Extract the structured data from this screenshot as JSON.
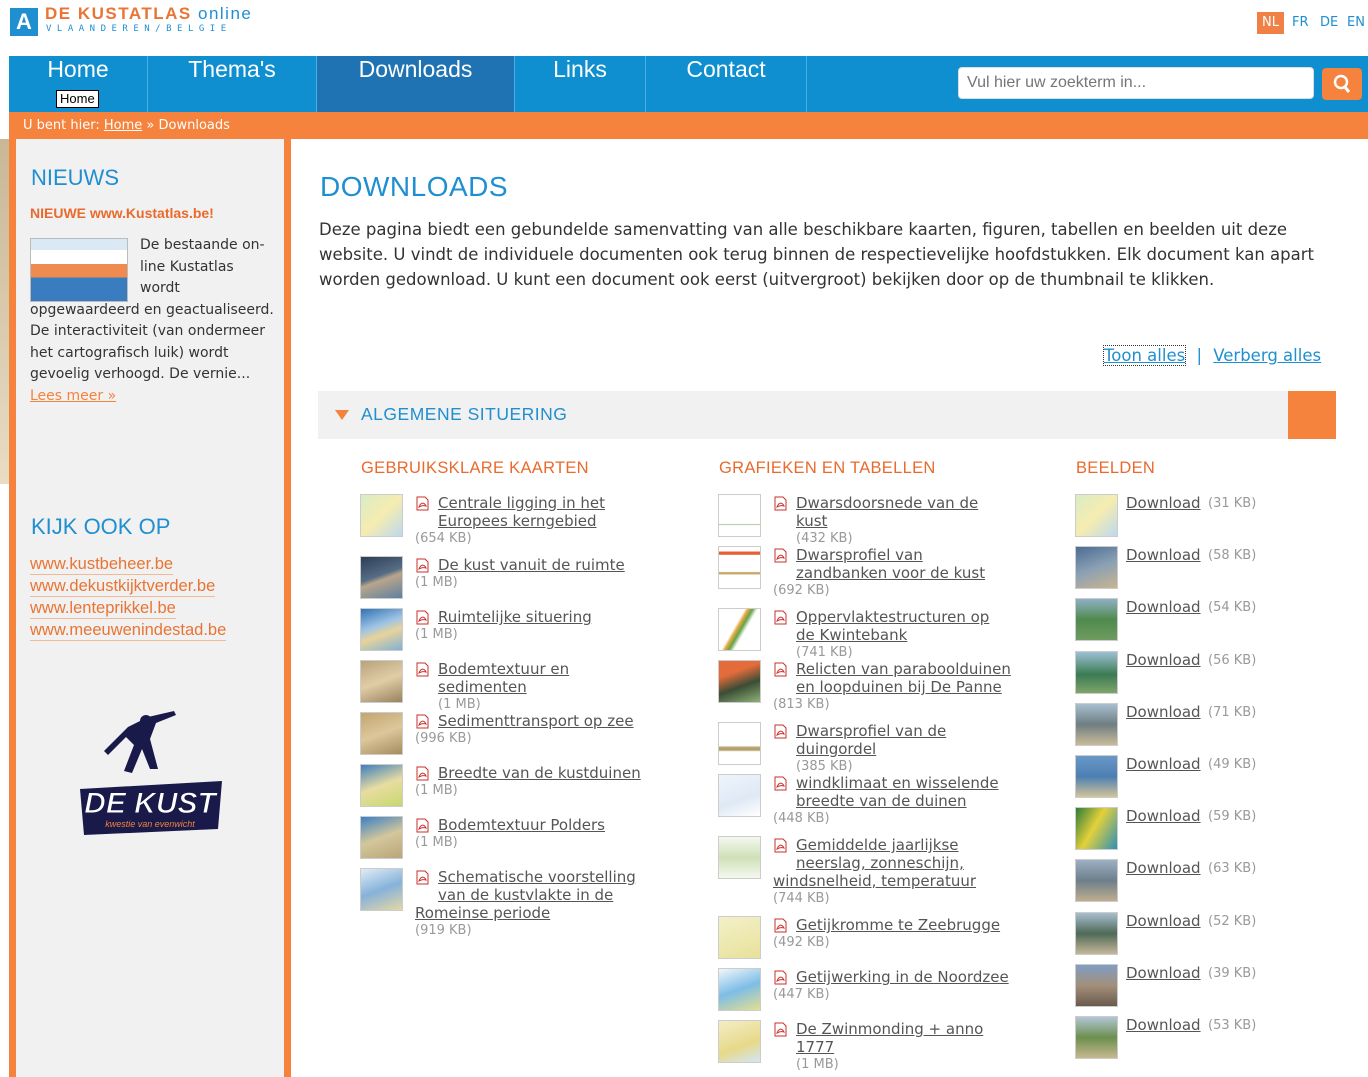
{
  "header": {
    "logo_letter": "A",
    "logo_title_part1": "DE KUSTATLAS",
    "logo_title_part2": "online",
    "logo_subtitle": "VLAANDEREN/BELGIE",
    "languages": [
      "NL",
      "FR",
      "DE",
      "EN"
    ],
    "active_language": "NL"
  },
  "nav": {
    "items": [
      "Home",
      "Thema's",
      "Downloads",
      "Links",
      "Contact"
    ],
    "active": "Downloads",
    "tooltip": "Home"
  },
  "search": {
    "placeholder": "Vul hier uw zoekterm in..."
  },
  "breadcrumb": {
    "prefix": "U bent hier:",
    "home": "Home",
    "separator": "»",
    "current": "Downloads"
  },
  "sidebar": {
    "news_heading": "NIEUWS",
    "news_title": "NIEUWE www.Kustatlas.be!",
    "news_text": "De bestaande on-line Kustatlas wordt opgewaardeerd en geactualiseerd. De interactiviteit (van ondermeer het cartografisch luik) wordt gevoelig verhoogd. De vernie...",
    "news_more": "Lees meer »",
    "see_also_heading": "KIJK OOK OP",
    "links": [
      "www.kustbeheer.be",
      "www.dekustkijktverder.be",
      "www.lenteprikkel.be",
      "www.meeuwenindestad.be"
    ],
    "logo_text": "DE KUST",
    "logo_tagline": "kwestie van evenwicht"
  },
  "main": {
    "title": "DOWNLOADS",
    "intro": "Deze pagina biedt een gebundelde samenvatting van alle beschikbare kaarten, figuren, tabellen en beelden uit deze website. U vindt de individuele documenten ook terug binnen de respectievelijke hoofdstukken. Elk document kan apart worden gedownload. U kunt een document ook eerst (uitvergroot) bekijken door op de thumbnail te klikken.",
    "show_all": "Toon alles",
    "toggle_sep": "|",
    "hide_all": "Verberg alles",
    "section": "ALGEMENE SITUERING",
    "columns": {
      "maps_heading": "GEBRUIKSKLARE KAARTEN",
      "charts_heading": "GRAFIEKEN EN TABELLEN",
      "images_heading": "BEELDEN"
    },
    "maps": [
      {
        "l1": "Centrale ligging in het",
        "l2": "Europees kerngebied",
        "l3": "",
        "size": "(654 KB)"
      },
      {
        "l1": "De kust vanuit de ruimte",
        "l2": "",
        "l3": "",
        "size": "(1 MB)"
      },
      {
        "l1": "Ruimtelijke situering",
        "l2": "",
        "l3": "",
        "size": "(1 MB)"
      },
      {
        "l1": "Bodemtextuur en",
        "l2": "sedimenten",
        "l3": "",
        "size": "(1 MB)"
      },
      {
        "l1": "Sedimenttransport op zee",
        "l2": "",
        "l3": "",
        "size": "(996 KB)"
      },
      {
        "l1": "Breedte van de kustduinen",
        "l2": "",
        "l3": "",
        "size": "(1 MB)"
      },
      {
        "l1": "Bodemtextuur Polders",
        "l2": "",
        "l3": "",
        "size": "(1 MB)"
      },
      {
        "l1": "Schematische voorstelling",
        "l2": "van de kustvlakte in de",
        "l3": "Romeinse periode",
        "size": "(919 KB)"
      }
    ],
    "charts": [
      {
        "l1": "Dwarsdoorsnede van de",
        "l2": "kust",
        "l3": "",
        "l4": "",
        "size": "(432 KB)"
      },
      {
        "l1": "Dwarsprofiel van",
        "l2": "zandbanken voor de kust",
        "l3": "",
        "l4": "",
        "size": "(692 KB)"
      },
      {
        "l1": "Oppervlaktestructuren op",
        "l2": "de Kwintebank",
        "l3": "",
        "l4": "",
        "size": "(741 KB)"
      },
      {
        "l1": "Relicten van paraboolduinen",
        "l2": "en loopduinen bij De Panne",
        "l3": "",
        "l4": "",
        "size": "(813 KB)"
      },
      {
        "l1": "Dwarsprofiel van de",
        "l2": "duingordel",
        "l3": "",
        "l4": "",
        "size": "(385 KB)"
      },
      {
        "l1": "windklimaat en wisselende",
        "l2": "breedte van de duinen",
        "l3": "",
        "l4": "",
        "size": "(448 KB)"
      },
      {
        "l1": "Gemiddelde jaarlijkse",
        "l2": "neerslag, zonneschijn,",
        "l3": "windsnelheid, temperatuur",
        "l4": "",
        "size": "(744 KB)"
      },
      {
        "l1": "Getijkromme te Zeebrugge",
        "l2": "",
        "l3": "",
        "l4": "",
        "size": "(492 KB)"
      },
      {
        "l1": "Getijwerking in de Noordzee",
        "l2": "",
        "l3": "",
        "l4": "",
        "size": "(447 KB)"
      },
      {
        "l1": "De Zwinmonding + anno",
        "l2": "1777",
        "l3": "",
        "l4": "",
        "size": "(1 MB)"
      }
    ],
    "images": [
      {
        "label": "Download",
        "size": "(31 KB)"
      },
      {
        "label": "Download",
        "size": "(58 KB)"
      },
      {
        "label": "Download",
        "size": "(54 KB)"
      },
      {
        "label": "Download",
        "size": "(56 KB)"
      },
      {
        "label": "Download",
        "size": "(71 KB)"
      },
      {
        "label": "Download",
        "size": "(49 KB)"
      },
      {
        "label": "Download",
        "size": "(59 KB)"
      },
      {
        "label": "Download",
        "size": "(63 KB)"
      },
      {
        "label": "Download",
        "size": "(52 KB)"
      },
      {
        "label": "Download",
        "size": "(39 KB)"
      },
      {
        "label": "Download",
        "size": "(53 KB)"
      }
    ]
  },
  "colors": {
    "brand_blue": "#1f8fd1",
    "brand_orange": "#f5823d",
    "nav_active": "#1f73b3"
  }
}
